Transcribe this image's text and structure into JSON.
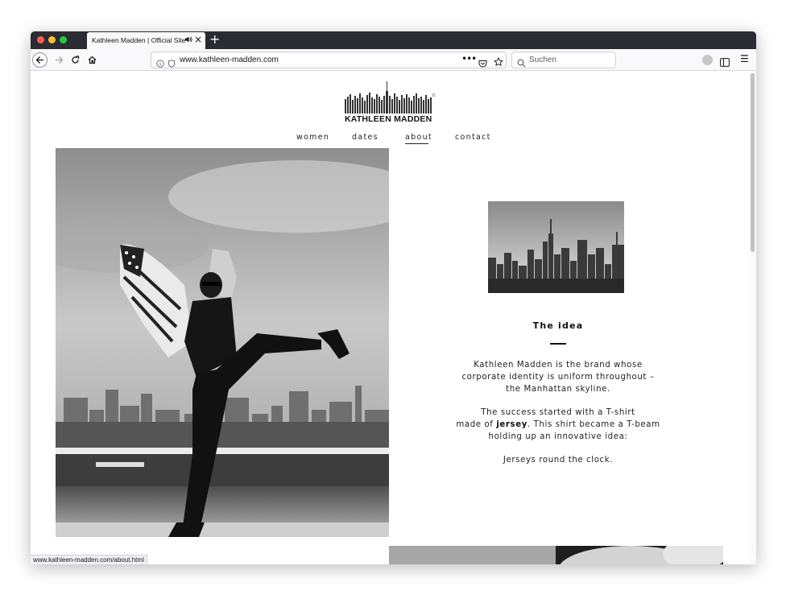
{
  "browser": {
    "tab": {
      "title": "Kathleen Madden | Official Site",
      "sound_icon": "speaker-icon",
      "close_icon": "close-icon"
    },
    "new_tab_label": "+",
    "url": {
      "prefix": "www.",
      "host": "kathleen-madden.com"
    },
    "url_more": "•••",
    "search": {
      "placeholder": "Suchen"
    },
    "menu_icon": "☰",
    "status_link": "www.kathleen-madden.com/about.html"
  },
  "site": {
    "logo_text": "KATHLEEN MADDEN",
    "nav": [
      {
        "label": "women"
      },
      {
        "label": "dates"
      },
      {
        "label": "about",
        "active": true
      },
      {
        "label": "contact"
      }
    ],
    "idea": {
      "title": "The idea",
      "paragraph1": [
        "Kathleen Madden is the brand whose",
        "corporate identity is uniform throughout –",
        "the Manhattan skyline."
      ],
      "paragraph2_line1": "The success started with a T-shirt",
      "paragraph2_line2_pre": "made of ",
      "paragraph2_line2_bold": "jersey",
      "paragraph2_line2_post": ". This shirt became a T-beam",
      "paragraph2_line3": "holding up an innovative idea:",
      "paragraph3": "Jerseys round the clock."
    }
  },
  "colors": {
    "tabstrip": "#2b2b33",
    "toolbar": "#f9f9fb",
    "text": "#222222"
  }
}
